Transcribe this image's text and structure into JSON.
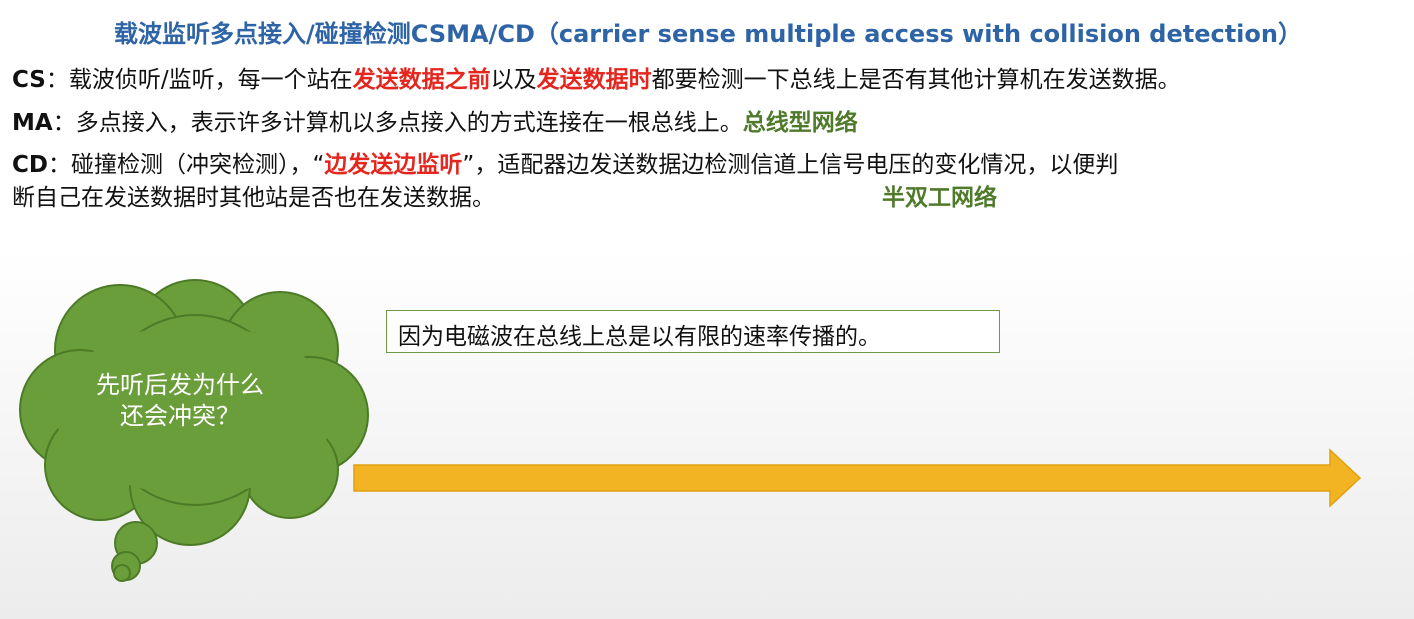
{
  "title": "载波监听多点接入/碰撞检测CSMA/CD（carrier sense multiple access with collision detection）",
  "cs": {
    "label": "CS",
    "text1": "：载波侦听/监听，每一个站在",
    "red1": "发送数据之前",
    "text2": "以及",
    "red2": "发送数据时",
    "text3": "都要检测一下总线上是否有其他计算机在发送数据。"
  },
  "ma": {
    "label": "MA",
    "text": "：多点接入，表示许多计算机以多点接入的方式连接在一根总线上。",
    "green": "总线型网络"
  },
  "cd": {
    "label": "CD",
    "text1": "：碰撞检测（冲突检测），“",
    "red": "边发送边监听",
    "text2": "”，适配器边发送数据边检测信道上信号电压的变化情况，以便判",
    "line2": "断自己在发送数据时其他站是否也在发送数据。",
    "green": "半双工网络"
  },
  "cloud": {
    "line1": "先听后发为什么",
    "line2": "还会冲突？"
  },
  "note": "因为电磁波在总线上总是以有限的速率传播的。",
  "colors": {
    "title_blue": "#2e64a6",
    "highlight_red": "#e4261e",
    "highlight_green": "#4f7a2a",
    "cloud_fill": "#6a9e3a",
    "arrow_fill": "#f2b422"
  }
}
